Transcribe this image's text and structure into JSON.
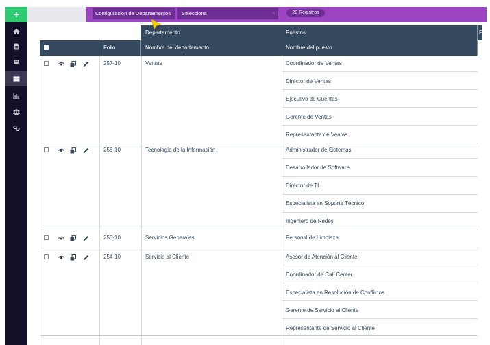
{
  "toolbar": {
    "add_label": "+",
    "config_label": "Configuracion de Departamentos",
    "select_label": "Selecciona",
    "select_clear": "×",
    "count_label": "20 Registros"
  },
  "sidebar": {
    "items": [
      {
        "icon": "home-icon"
      },
      {
        "icon": "document-icon"
      },
      {
        "icon": "book-icon"
      },
      {
        "icon": "list-icon",
        "active": true
      },
      {
        "icon": "bar-chart-icon"
      },
      {
        "icon": "users-icon"
      },
      {
        "icon": "link-icon"
      }
    ]
  },
  "table": {
    "group_headers": {
      "departamento": "Departamento",
      "puestos": "Puestos",
      "extra": "P"
    },
    "headers": {
      "folio": "Folio",
      "nombre": "Nombre del departamento",
      "puesto": "Nombre del puesto"
    },
    "rows": [
      {
        "folio": "257-10",
        "nombre": "Ventas",
        "puestos": [
          "Coordinador de Ventas",
          "Director de Ventas",
          "Ejecutivo de Cuentas",
          "Gerente de Ventas",
          "Representante de Ventas"
        ]
      },
      {
        "folio": "256-10",
        "nombre": "Tecnología de la Información",
        "puestos": [
          "Administrador de Sistemas",
          "Desarrollador de Software",
          "Director de TI",
          "Especialista en Soporte Técnico",
          "Ingeniero de Redes"
        ]
      },
      {
        "folio": "255-10",
        "nombre": "Servicios Generales",
        "puestos": [
          "Personal de Limpieza"
        ]
      },
      {
        "folio": "254-10",
        "nombre": "Servicio al Cliente",
        "puestos": [
          "Asesor de Atención al Cliente",
          "Coordinador de Call Center",
          "Especialista en Resolución de Conflictos",
          "Gerente de Servicio al Cliente",
          "Representante de Servicio al Cliente"
        ]
      }
    ]
  },
  "colors": {
    "accent_purple": "#9b45c2",
    "dark_purple": "#6d2f93",
    "header": "#34495e",
    "sidebar": "#13102a",
    "add_green": "#2ecc71"
  }
}
